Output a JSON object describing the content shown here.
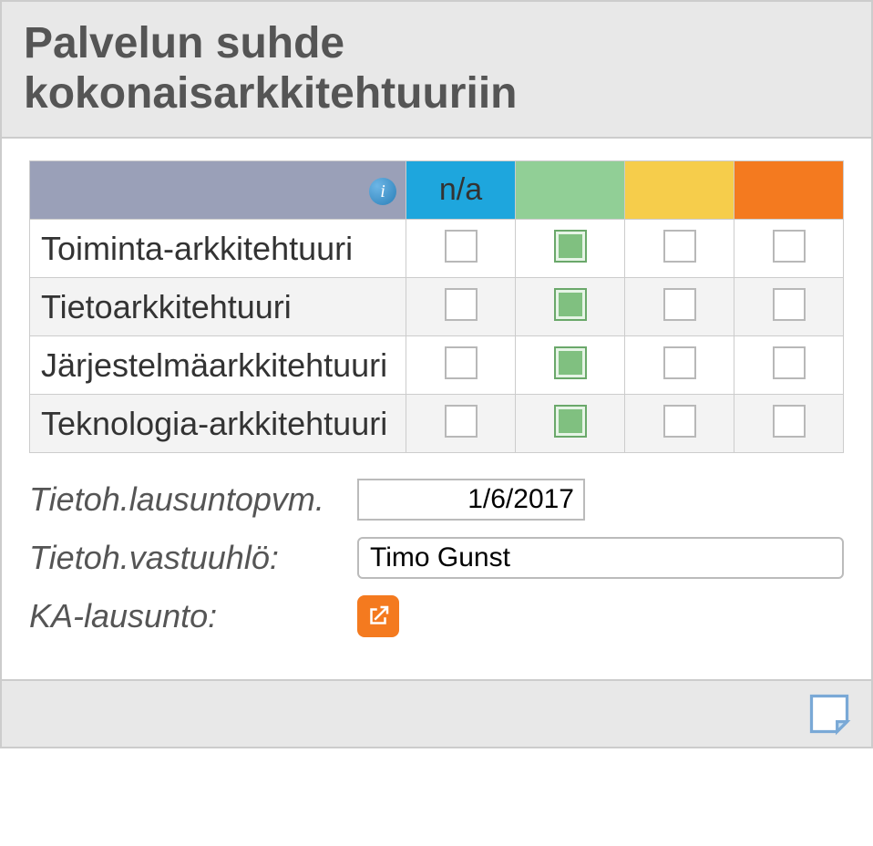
{
  "panel": {
    "title": "Palvelun suhde kokonaisarkkitehtuuriin"
  },
  "matrix": {
    "columns": {
      "na": "n/a",
      "green": "",
      "yellow": "",
      "orange": ""
    },
    "rows": [
      {
        "label": "Toiminta-arkkitehtuuri",
        "na": false,
        "green": true,
        "yellow": false,
        "orange": false
      },
      {
        "label": "Tietoarkkitehtuuri",
        "na": false,
        "green": true,
        "yellow": false,
        "orange": false
      },
      {
        "label": "Järjestelmäarkkitehtuuri",
        "na": false,
        "green": true,
        "yellow": false,
        "orange": false
      },
      {
        "label": "Teknologia-arkkitehtuuri",
        "na": false,
        "green": true,
        "yellow": false,
        "orange": false
      }
    ]
  },
  "fields": {
    "date_label": "Tietoh.lausuntopvm.",
    "date_value": "1/6/2017",
    "person_label": "Tietoh.vastuuhlö:",
    "person_value": "Timo Gunst",
    "link_label": "KA-lausunto:"
  }
}
